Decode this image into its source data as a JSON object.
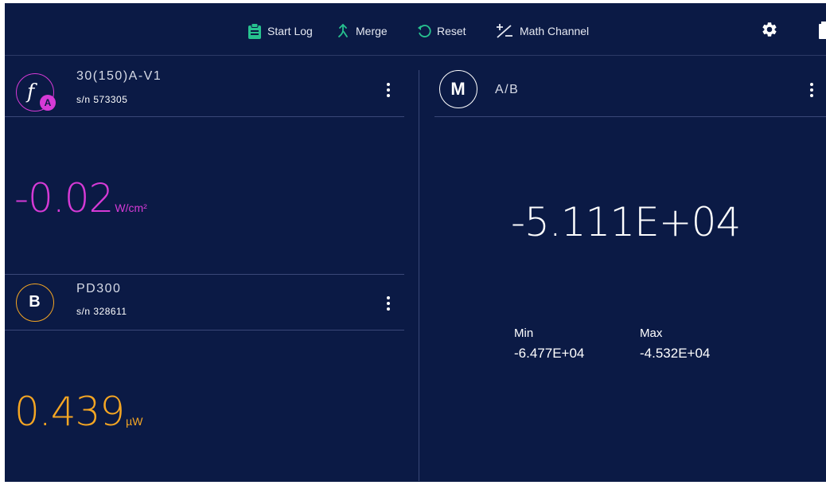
{
  "toolbar": {
    "start_log": "Start Log",
    "merge": "Merge",
    "reset": "Reset",
    "math_channel": "Math Channel",
    "icons": {
      "start_log": "clipboard-icon",
      "merge": "merge-icon",
      "reset": "reset-icon",
      "math_channel": "plus-minus-icon",
      "settings": "gear-icon",
      "battery": "battery-icon"
    },
    "colors": {
      "accent_green": "#27c28f"
    }
  },
  "channel_a": {
    "badge_symbol": "f",
    "badge_letter": "A",
    "name": "30(150)A-V1",
    "serial": "s/n 573305",
    "value": "-0.02",
    "unit": "W/cm²",
    "color": "#d63ad6"
  },
  "channel_b": {
    "badge_letter": "B",
    "name": "PD300",
    "serial": "s/n 328611",
    "value": "0.439",
    "unit": "µW",
    "color": "#f5a623"
  },
  "math_channel": {
    "badge_letter": "M",
    "name": "A/B",
    "value": "-5.111E+04",
    "min_label": "Min",
    "min_value": "-6.477E+04",
    "max_label": "Max",
    "max_value": "-4.532E+04"
  },
  "theme": {
    "background": "#0b1a45",
    "divider": "#3a4878"
  }
}
